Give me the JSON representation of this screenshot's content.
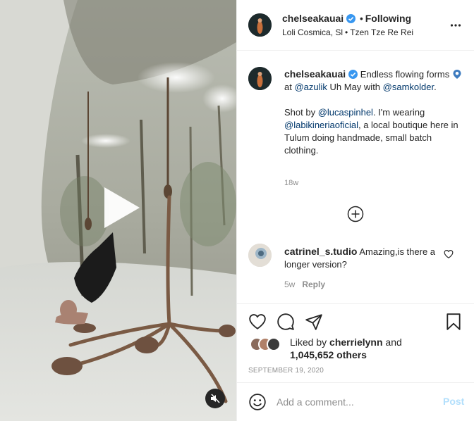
{
  "colors": {
    "link": "#00376b",
    "verified": "#3897f0",
    "muted": "#8e8e8e",
    "post_disabled": "#b2dffc"
  },
  "media": {
    "type": "video",
    "play_icon": "play-icon",
    "mute_icon": "muted-speaker-icon"
  },
  "header": {
    "username": "chelseakauai",
    "verified_icon": "verified-badge-icon",
    "dot": "•",
    "following": "Following",
    "location": "Loli Cosmica, Sl",
    "location_sep": "•",
    "audio": "Tzen Tze Re Rei",
    "more_icon": "more-options-icon"
  },
  "caption": {
    "username": "chelseakauai",
    "p1_text1": "Endless flowing forms ",
    "p1_text2": "at ",
    "p1_mention1": "@azulik",
    "p1_text3": " Uh May with ",
    "p1_mention2": "@samkolder",
    "p1_text4": ".",
    "p2_text1": "Shot by ",
    "p2_mention1": "@lucaspinhel",
    "p2_text2": ". I'm wearing ",
    "p2_mention2": "@labikineriaoficial",
    "p2_text3": ", a local boutique here in Tulum doing handmade, small batch clothing.",
    "time": "18w",
    "load_more_icon": "plus-circle-icon"
  },
  "comment": {
    "username": "catrinel_s.tudio",
    "text": " Amazing,is there a longer version?",
    "time": "5w",
    "reply": "Reply",
    "like_icon": "heart-outline-icon"
  },
  "actions": {
    "icons": [
      "heart-icon",
      "comment-icon",
      "share-icon",
      "bookmark-icon"
    ],
    "liked_by_prefix": "Liked by ",
    "liked_by_user": "cherrielynn",
    "liked_by_and": " and",
    "liked_count": "1,045,652 others",
    "date": "SEPTEMBER 19, 2020"
  },
  "add_comment": {
    "emoji_icon": "emoji-icon",
    "placeholder": "Add a comment...",
    "post": "Post"
  }
}
